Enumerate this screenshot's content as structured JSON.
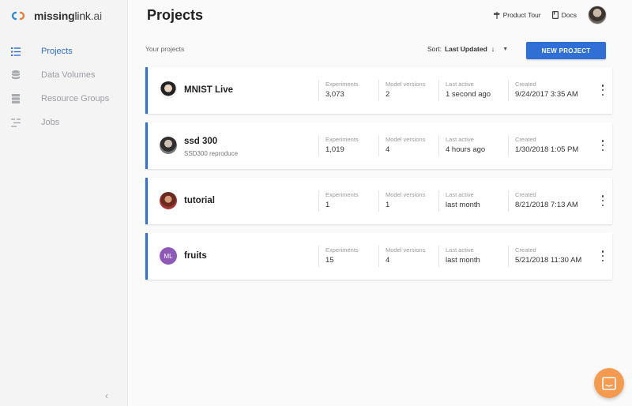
{
  "app": {
    "logo_bold": "missing",
    "logo_rest": "link",
    "logo_suffix": ".ai",
    "accent_color": "#2f6fd6",
    "chat_color": "#f59b4f"
  },
  "sidebar": {
    "items": [
      {
        "label": "Projects",
        "icon": "list-icon",
        "active": true
      },
      {
        "label": "Data Volumes",
        "icon": "database-icon",
        "active": false
      },
      {
        "label": "Resource Groups",
        "icon": "server-icon",
        "active": false
      },
      {
        "label": "Jobs",
        "icon": "jobs-icon",
        "active": false
      }
    ],
    "collapse_glyph": "‹"
  },
  "header": {
    "title": "Projects",
    "product_tour": "Product Tour",
    "docs": "Docs"
  },
  "toolbar": {
    "subtitle": "Your projects",
    "sort_label": "Sort:",
    "sort_value": "Last Updated",
    "sort_arrow": "↓",
    "sort_caret": "▼",
    "new_project": "NEW PROJECT"
  },
  "columns": {
    "experiments": "Experiments",
    "model_versions": "Model versions",
    "last_active": "Last active",
    "created": "Created"
  },
  "projects": [
    {
      "name": "MNIST Live",
      "description": "",
      "avatar_initials": "",
      "experiments": "3,073",
      "model_versions": "2",
      "last_active": "1 second ago",
      "created": "9/24/2017 3:35 AM"
    },
    {
      "name": "ssd 300",
      "description": "SSD300 reproduce",
      "avatar_initials": "",
      "experiments": "1,019",
      "model_versions": "4",
      "last_active": "4 hours ago",
      "created": "1/30/2018 1:05 PM"
    },
    {
      "name": "tutorial",
      "description": "",
      "avatar_initials": "",
      "experiments": "1",
      "model_versions": "1",
      "last_active": "last month",
      "created": "8/21/2018 7:13 AM"
    },
    {
      "name": "fruits",
      "description": "",
      "avatar_initials": "ML",
      "experiments": "15",
      "model_versions": "4",
      "last_active": "last month",
      "created": "5/21/2018 11:30 AM"
    }
  ]
}
